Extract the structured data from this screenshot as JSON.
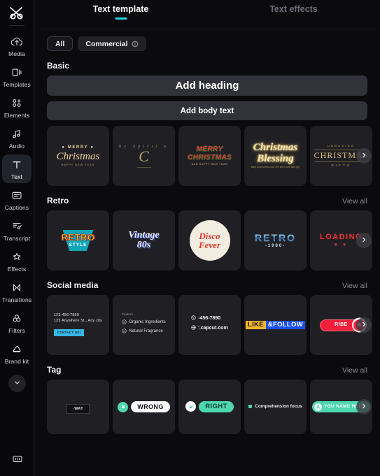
{
  "sidebar": {
    "logo_icon": "capcut-logo-icon",
    "items": [
      {
        "label": "Media",
        "icon": "cloud-upload-icon",
        "active": false
      },
      {
        "label": "Templates",
        "icon": "templates-icon",
        "active": false
      },
      {
        "label": "Elements",
        "icon": "elements-icon",
        "active": false
      },
      {
        "label": "Audio",
        "icon": "music-note-icon",
        "active": false
      },
      {
        "label": "Text",
        "icon": "text-t-icon",
        "active": true
      },
      {
        "label": "Captions",
        "icon": "captions-icon",
        "active": false
      },
      {
        "label": "Transcript",
        "icon": "transcript-icon",
        "active": false
      },
      {
        "label": "Effects",
        "icon": "sparkle-star-icon",
        "active": false
      },
      {
        "label": "Transitions",
        "icon": "transitions-icon",
        "active": false
      },
      {
        "label": "Filters",
        "icon": "filters-circles-icon",
        "active": false
      },
      {
        "label": "Brand kit",
        "icon": "brand-kit-icon",
        "active": false
      }
    ],
    "expand_icon": "chevron-down-icon",
    "bottom_icon": "keyboard-shortcuts-icon"
  },
  "tabs": [
    {
      "label": "Text template",
      "active": true
    },
    {
      "label": "Text effects",
      "active": false
    }
  ],
  "filters": [
    {
      "label": "All",
      "selected": true,
      "info": false
    },
    {
      "label": "Commercial",
      "selected": false,
      "info": true,
      "info_icon": "info-circle-icon"
    }
  ],
  "basic": {
    "title": "Basic",
    "add_heading": "Add heading",
    "add_body_text": "Add body text"
  },
  "view_all_label": "View all",
  "next_arrow_icon": "chevron-right-icon",
  "sections": [
    {
      "title": "",
      "show_view_all": false,
      "tiles": [
        {
          "name": "merry-christmas",
          "lines": [
            "MERRY",
            "Christmas",
            "HAPPY NEW YEAR"
          ]
        },
        {
          "name": "the-spirit-of",
          "lines": [
            "he  Spirit  o",
            "C"
          ]
        },
        {
          "name": "merry-christmas-retro",
          "lines": [
            "MERRY",
            "CHRISTMAS",
            "AND HAPPY NEW YEAR"
          ]
        },
        {
          "name": "christmas-blessing",
          "lines": [
            "Christmas",
            "Blessing",
            "May God bless your life with love and joy"
          ]
        },
        {
          "name": "unboxing-christmas-gifts",
          "lines": [
            "UNBOXING",
            "CHRISTMAS",
            "GIFTS"
          ]
        }
      ]
    },
    {
      "title": "Retro",
      "show_view_all": true,
      "tiles": [
        {
          "name": "retro-style",
          "lines": [
            "RETRO",
            "STYLE"
          ]
        },
        {
          "name": "vintage-80s",
          "lines": [
            "Vintage",
            "80s"
          ]
        },
        {
          "name": "disco-fever",
          "lines": [
            "Disco",
            "Fever"
          ]
        },
        {
          "name": "retro-1980",
          "lines": [
            "RETRO",
            "-1980-"
          ]
        },
        {
          "name": "loading",
          "lines": [
            "LOADING",
            "♥ ♥"
          ]
        }
      ]
    },
    {
      "title": "Social media",
      "show_view_all": true,
      "tiles": [
        {
          "name": "contact-card",
          "lines": [
            "123-456-7890",
            "123 Anywhere St., Any city",
            "CONTACT US!"
          ]
        },
        {
          "name": "feature-list",
          "lines": [
            "Feature",
            "Organic Ingredients",
            "Natural Fragrance"
          ]
        },
        {
          "name": "contact-info",
          "lines": [
            "-456-7890",
            "'.capcut.com"
          ]
        },
        {
          "name": "like-and-follow",
          "lines": [
            "LIKE",
            "&FOLLOW"
          ]
        },
        {
          "name": "subscribe-bell",
          "lines": [
            "RIBE"
          ]
        }
      ]
    },
    {
      "title": "Tag",
      "show_view_all": true,
      "tiles": [
        {
          "name": "watermark-tag",
          "lines": [
            "·WAT"
          ]
        },
        {
          "name": "wrong-tag",
          "lines": [
            "WRONG"
          ]
        },
        {
          "name": "right-tag",
          "lines": [
            "RIGHT"
          ]
        },
        {
          "name": "comprehension-focus-tag",
          "lines": [
            "Comprehension focus"
          ]
        },
        {
          "name": "you-name-here-tag",
          "lines": [
            "YOU NAME HERE"
          ]
        }
      ]
    }
  ],
  "colors": {
    "accent": "#2ad4e0",
    "background": "#0b0b0d",
    "sidebar_background": "#08080a",
    "tile_background": "#202024",
    "button_background": "#32323a",
    "active_nav_background": "#21242c"
  }
}
